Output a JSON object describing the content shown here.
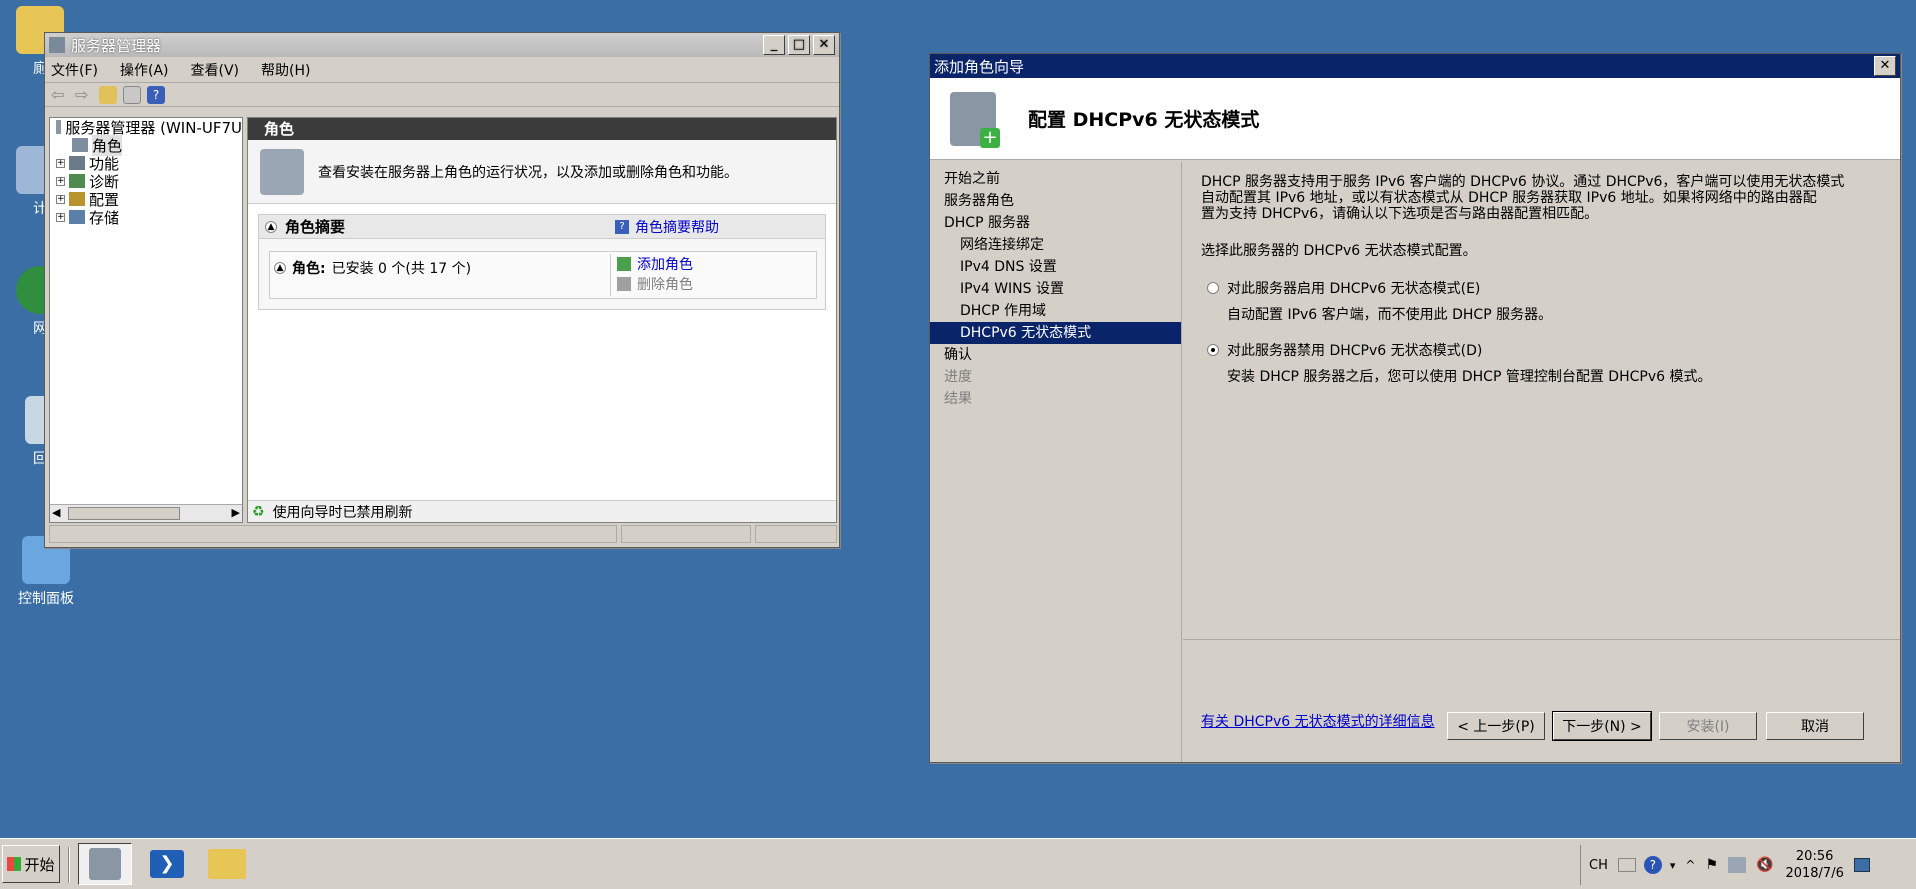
{
  "desktop": {
    "icons": [
      {
        "label": "廁"
      },
      {
        "label": "计"
      },
      {
        "label": "网"
      },
      {
        "label": "回"
      },
      {
        "label": "控制面板"
      }
    ]
  },
  "server_manager": {
    "title": "服务器管理器",
    "menu": [
      "文件(F)",
      "操作(A)",
      "查看(V)",
      "帮助(H)"
    ],
    "tree": {
      "root": "服务器管理器 (WIN-UF7U",
      "items": [
        "角色",
        "功能",
        "诊断",
        "配置",
        "存储"
      ]
    },
    "panel_header": "角色",
    "description": "查看安装在服务器上角色的运行状况，以及添加或删除角色和功能。",
    "summary_title": "角色摘要",
    "summary_help": "角色摘要帮助",
    "roles_label": "角色:",
    "roles_count": "已安装 0 个(共 17 个)",
    "add_roles": "添加角色",
    "remove_roles": "删除角色",
    "status": "使用向导时已禁用刷新"
  },
  "wizard": {
    "title": "添加角色向导",
    "heading": "配置 DHCPv6 无状态模式",
    "nav": [
      {
        "label": "开始之前",
        "state": "normal",
        "indent": false
      },
      {
        "label": "服务器角色",
        "state": "normal",
        "indent": false
      },
      {
        "label": "DHCP 服务器",
        "state": "normal",
        "indent": false
      },
      {
        "label": "网络连接绑定",
        "state": "normal",
        "indent": true
      },
      {
        "label": "IPv4 DNS 设置",
        "state": "normal",
        "indent": true
      },
      {
        "label": "IPv4 WINS 设置",
        "state": "normal",
        "indent": true
      },
      {
        "label": "DHCP 作用域",
        "state": "normal",
        "indent": true
      },
      {
        "label": "DHCPv6 无状态模式",
        "state": "selected",
        "indent": true
      },
      {
        "label": "确认",
        "state": "normal",
        "indent": false
      },
      {
        "label": "进度",
        "state": "disabled",
        "indent": false
      },
      {
        "label": "结果",
        "state": "disabled",
        "indent": false
      }
    ],
    "intro_lines": [
      "DHCP 服务器支持用于服务 IPv6 客户端的 DHCPv6 协议。通过 DHCPv6，客户端可以使用无状态模式",
      "自动配置其 IPv6 地址，或以有状态模式从 DHCP 服务器获取 IPv6 地址。如果将网络中的路由器配",
      "置为支持 DHCPv6，请确认以下选项是否与路由器配置相匹配。"
    ],
    "prompt": "选择此服务器的 DHCPv6 无状态模式配置。",
    "option_enable": "对此服务器启用 DHCPv6 无状态模式(E)",
    "option_enable_desc": "自动配置 IPv6 客户端，而不使用此 DHCP 服务器。",
    "option_disable": "对此服务器禁用 DHCPv6 无状态模式(D)",
    "option_disable_desc": "安装 DHCP 服务器之后，您可以使用 DHCP 管理控制台配置 DHCPv6 模式。",
    "selected_option": "disable",
    "more_info": "有关 DHCPv6 无状态模式的详细信息",
    "buttons": {
      "back": "< 上一步(P)",
      "next": "下一步(N) >",
      "install": "安装(I)",
      "cancel": "取消"
    }
  },
  "taskbar": {
    "start": "开始",
    "lang": "CH",
    "time": "20:56",
    "date": "2018/7/6"
  }
}
